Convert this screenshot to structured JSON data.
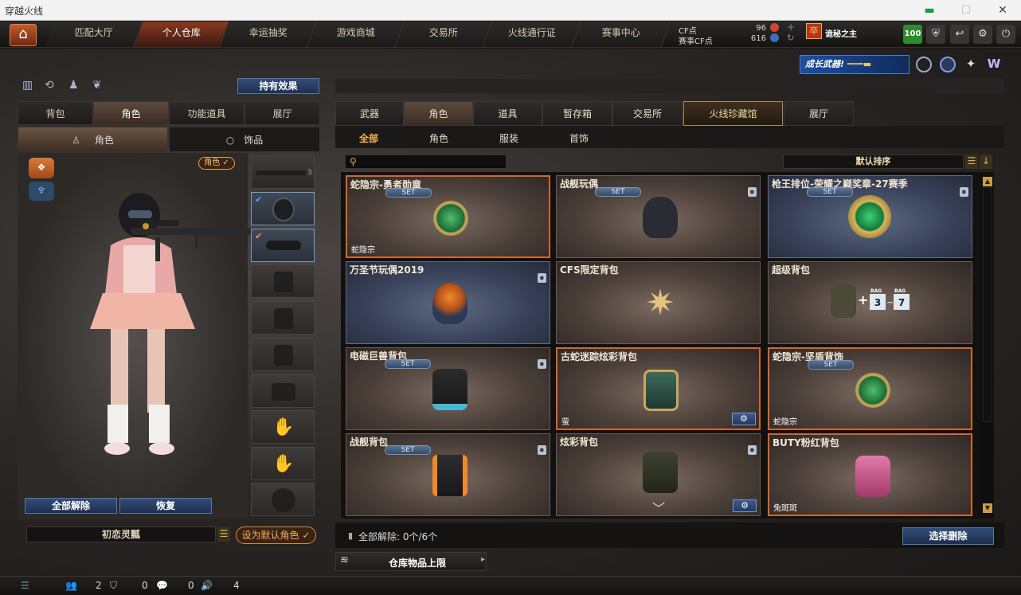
{
  "window": {
    "title": "穿越火线"
  },
  "nav": {
    "tabs": [
      "匹配大厅",
      "个人仓库",
      "幸运抽奖",
      "游戏商城",
      "交易所",
      "火线通行证",
      "赛事中心"
    ],
    "cf_label": "CF点",
    "cf_value": "96",
    "match_cf_label": "赛事CF点",
    "match_cf_value": "616",
    "username": "诡秘之主",
    "level": "100"
  },
  "banner": {
    "text": "成长武器!"
  },
  "left": {
    "effects_button": "持有效果",
    "tabs": [
      "背包",
      "角色",
      "功能道具",
      "展厅"
    ],
    "subtabs": [
      "角色",
      "饰品"
    ],
    "role_badge": "角色",
    "unequip_all": "全部解除",
    "restore": "恢复",
    "character_name": "初恋灵瓢",
    "set_default": "设为默认角色"
  },
  "right": {
    "tabs": [
      "武器",
      "角色",
      "道具",
      "暂存箱",
      "交易所",
      "火线珍藏馆",
      "展厅"
    ],
    "filters": [
      "全部",
      "角色",
      "服装",
      "首饰"
    ],
    "sort_label": "默认排序",
    "search_placeholder": "",
    "cards": [
      {
        "name": "蛇隐宗-勇者勋章",
        "set": "SET",
        "tag": "蛇隐宗"
      },
      {
        "name": "战舰玩偶",
        "set": "SET",
        "tag": ""
      },
      {
        "name": "枪王排位-荣耀之巅奖章-27赛季",
        "set": "SET",
        "tag": ""
      },
      {
        "name": "万圣节玩偶2019",
        "set": "",
        "tag": ""
      },
      {
        "name": "CFS限定背包",
        "set": "",
        "tag": ""
      },
      {
        "name": "超级背包",
        "set": "",
        "tag": "",
        "bag_from": "3",
        "bag_to": "7",
        "bag_label": "BAG"
      },
      {
        "name": "电磁巨兽背包",
        "set": "SET",
        "tag": ""
      },
      {
        "name": "古蛇迷踪炫彩背包",
        "set": "",
        "tag": "萤"
      },
      {
        "name": "蛇隐宗-坚盾背饰",
        "set": "SET",
        "tag": "蛇隐宗"
      },
      {
        "name": "战舰背包",
        "set": "SET",
        "tag": ""
      },
      {
        "name": "炫彩背包",
        "set": "",
        "tag": ""
      },
      {
        "name": "BUTY粉红背包",
        "set": "",
        "tag": "兔斑斑"
      }
    ],
    "unequip_all_text": "全部解除: 0个/6个",
    "select_delete": "选择删除",
    "storage_limit": "仓库物品上限"
  },
  "bottombar": {
    "friends": "2",
    "shield": "0",
    "chat": "0",
    "volume": "4"
  },
  "colors": {
    "accent_orange": "#d4662e",
    "accent_gold": "#f7b54a",
    "nav_active": "#8a3a22"
  }
}
